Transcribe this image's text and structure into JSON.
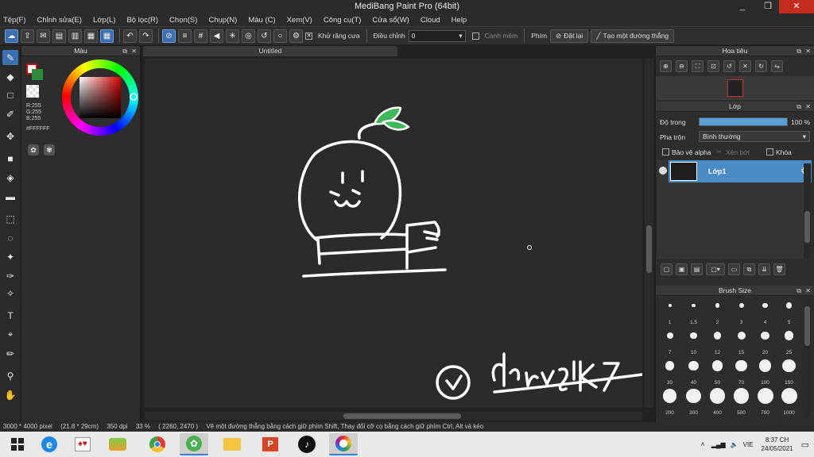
{
  "app": {
    "title": "MediBang Paint Pro (64bit)",
    "window_buttons": [
      "_",
      "❐",
      "✕"
    ]
  },
  "menu": [
    "Tệp(F)",
    "Chỉnh sửa(E)",
    "Lớp(L)",
    "Bộ lọc(R)",
    "Chọn(S)",
    "Chụp(N)",
    "Màu (C)",
    "Xem(V)",
    "Công cụ(T)",
    "Cửa sổ(W)",
    "Cloud",
    "Help"
  ],
  "toolbar": {
    "antialias_label": "Khử răng cưa",
    "correction_label": "Điều chỉnh",
    "correction_value": "0",
    "snap_label": "Canh mềm",
    "key_label": "Phím",
    "reset_label": "Đặt lại",
    "line_label": "Tạo một đường thẳng"
  },
  "color_panel": {
    "title": "Màu",
    "r": "R:255",
    "g": "G:255",
    "b": "B:255",
    "hex": "#FFFFFF"
  },
  "document": {
    "tab": "Untitled"
  },
  "navigator": {
    "title": "Hoa tiêu"
  },
  "layer_panel": {
    "title": "Lớp",
    "opacity_label": "Độ trong",
    "opacity_value": "100 %",
    "opacity_level": 100,
    "blend_label": "Pha trộn",
    "blend_value": "Bình thường",
    "protect_alpha_label": "Bảo vệ alpha",
    "clipping_label": "Xén bớt",
    "lock_label": "Khóa",
    "layers": [
      {
        "name": "Lớp1"
      }
    ]
  },
  "brush_size": {
    "title": "Brush Size",
    "sizes": [
      "1",
      "1.5",
      "2",
      "3",
      "4",
      "5",
      "7",
      "10",
      "12",
      "15",
      "20",
      "25",
      "30",
      "40",
      "50",
      "70",
      "100",
      "150",
      "200",
      "300",
      "400",
      "500",
      "700",
      "1000"
    ]
  },
  "status": {
    "size": "3000 * 4000 pixel",
    "cm": "(21.8 * 29cm)",
    "dpi": "350 dpi",
    "zoom": "33 %",
    "coords": "( 2260, 2470 )",
    "hint": "Vẽ một đường thẳng bằng cách giữ phím Shift, Thay đổi cỡ cọ bằng cách giữ phím Ctrl, Alt và kéo"
  },
  "taskbar": {
    "lang": "VIE",
    "time": "8:37 CH",
    "date": "24/05/2021"
  },
  "colors": {
    "accent": "#3d6fb0",
    "layer_selected": "#4a8ac6",
    "titlebar": "#2b2b2b",
    "close": "#c42b1c"
  }
}
